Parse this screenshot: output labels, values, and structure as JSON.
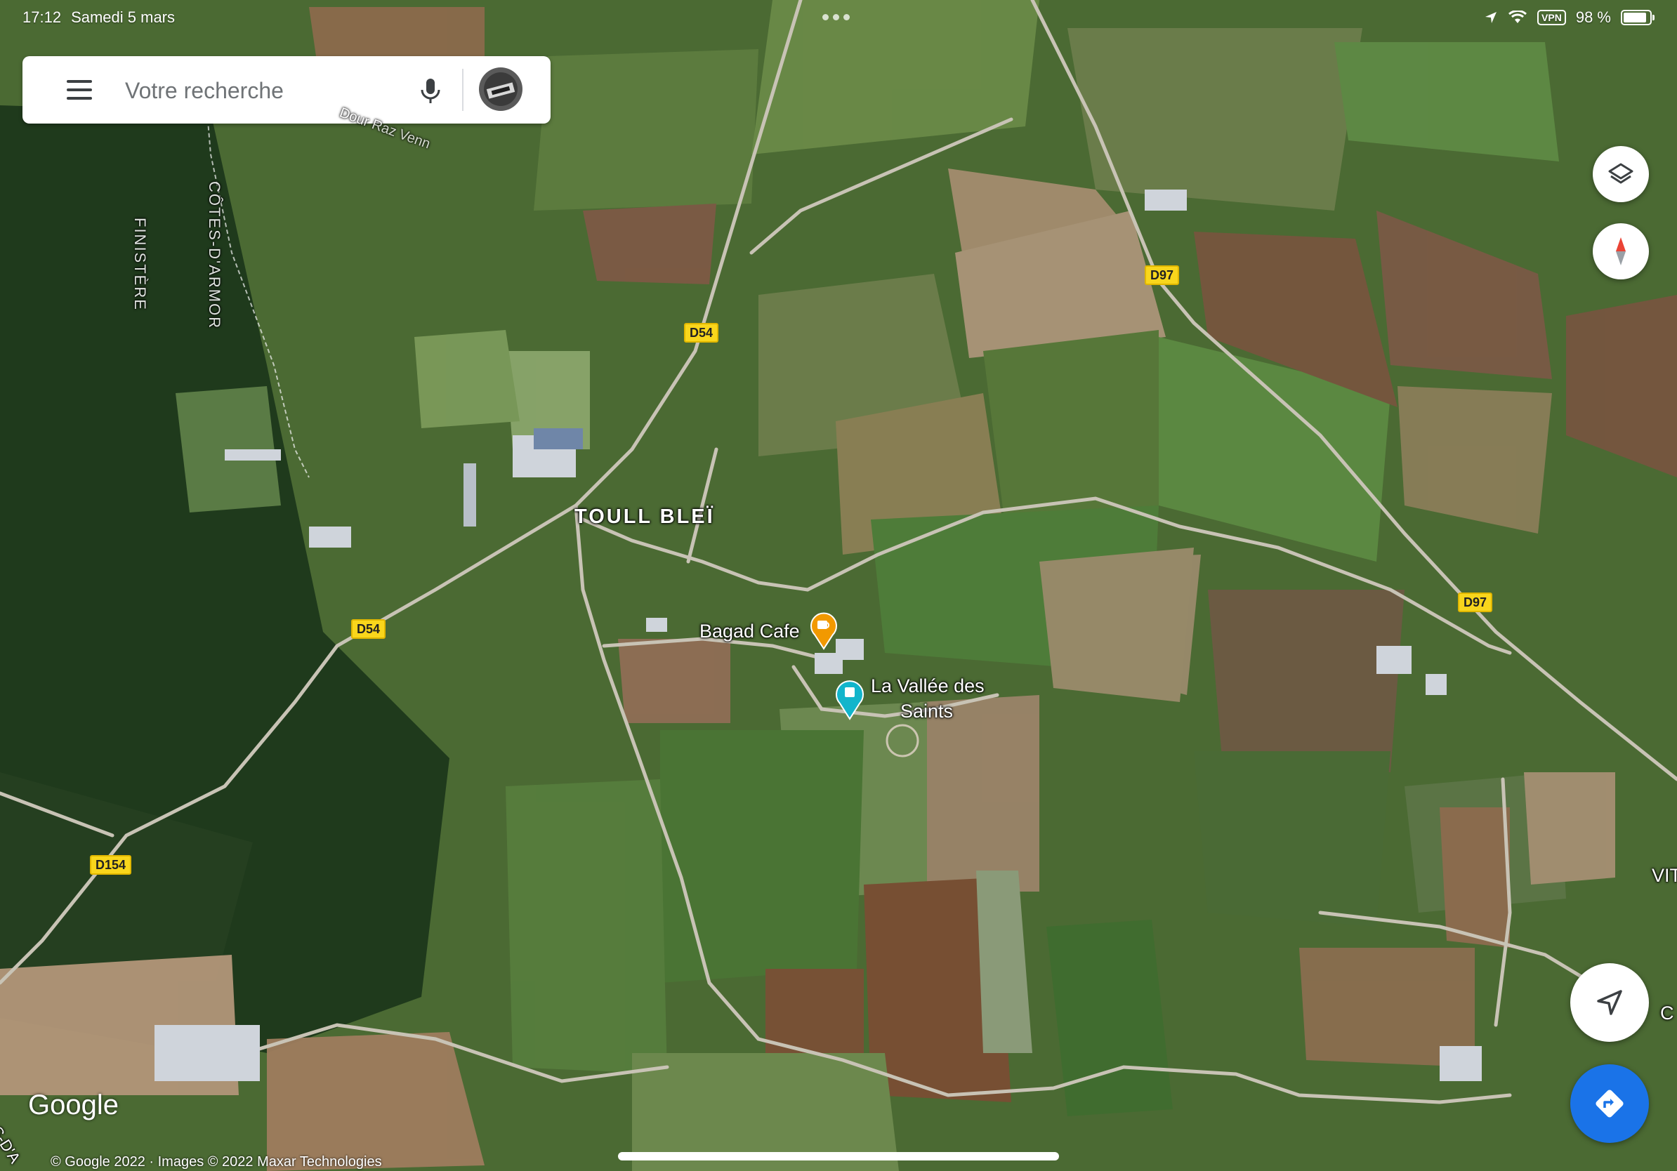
{
  "status_bar": {
    "time": "17:12",
    "date": "Samedi 5 mars",
    "vpn": "VPN",
    "battery": "98 %"
  },
  "search": {
    "placeholder": "Votre recherche",
    "menu_icon": "hamburger-menu-icon",
    "mic_icon": "microphone-icon"
  },
  "map": {
    "type": "satellite",
    "region_labels": {
      "finistere": "FINISTÈRE",
      "cotes_darmor": "CÔTES-D'ARMOR"
    },
    "stream_label": "Dour Raz Venn",
    "village": "TOULL BLEÏ",
    "roads": {
      "d54_a": "D54",
      "d54_b": "D54",
      "d97_a": "D97",
      "d97_b": "D97",
      "d154": "D154"
    },
    "pois": {
      "cafe": {
        "name": "Bagad Cafe",
        "icon": "coffee-cup-icon",
        "color": "#f29900"
      },
      "vallee": {
        "name_line1": "La Vallée des",
        "name_line2": "Saints",
        "icon": "landmark-pin-icon",
        "color": "#12b5cb"
      }
    },
    "edge_labels": {
      "right1": "VIT",
      "right2": "C",
      "bottom_left": "S-D'A"
    }
  },
  "controls": {
    "layers_icon": "layers-icon",
    "compass_icon": "compass-icon",
    "locate_icon": "location-arrow-icon",
    "directions_icon": "directions-icon",
    "directions_color": "#1a73e8"
  },
  "footer": {
    "logo": "Google",
    "attribution": "© Google 2022 · Images © 2022 Maxar Technologies"
  }
}
